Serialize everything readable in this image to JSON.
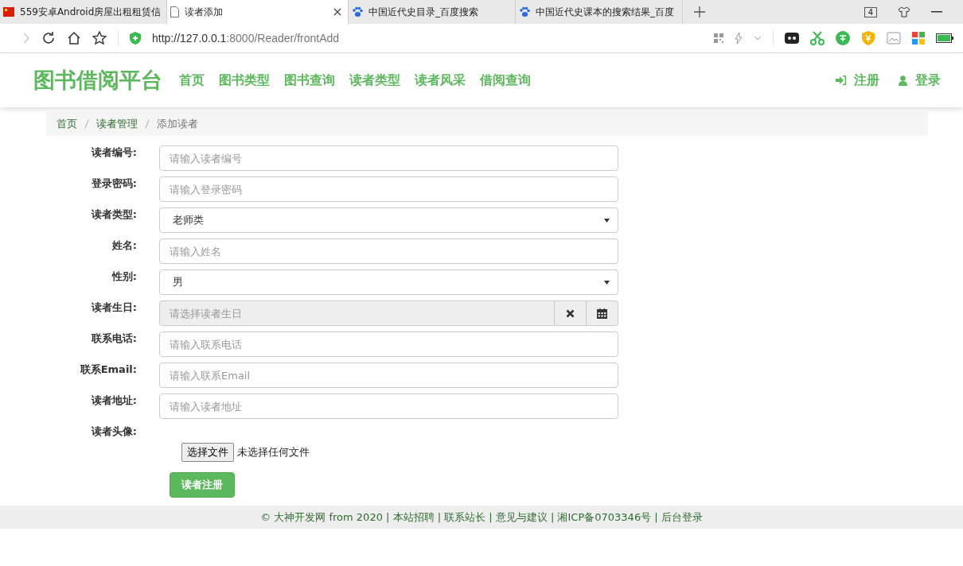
{
  "browser": {
    "tabs": [
      {
        "title": "559安卓Android房屋出租租赁信",
        "selected": false
      },
      {
        "title": "读者添加",
        "selected": true
      },
      {
        "title": "中国近代史目录_百度搜索",
        "selected": false
      },
      {
        "title": "中国近代史课本的搜索结果_百度",
        "selected": false
      }
    ],
    "tab_count": "4",
    "url_host": "http://127.0.0.1",
    "url_rest": ":8000/Reader/frontAdd"
  },
  "navbar": {
    "brand": "图书借阅平台",
    "links": [
      "首页",
      "图书类型",
      "图书查询",
      "读者类型",
      "读者风采",
      "借阅查询"
    ],
    "actions": [
      "注册",
      "登录"
    ]
  },
  "breadcrumb": [
    "首页",
    "读者管理",
    "添加读者"
  ],
  "form": {
    "fields": [
      {
        "label": "读者编号:",
        "kind": "text",
        "placeholder": "请输入读者编号"
      },
      {
        "label": "登录密码:",
        "kind": "text",
        "placeholder": "请输入登录密码"
      },
      {
        "label": "读者类型:",
        "kind": "select",
        "value": "老师类"
      },
      {
        "label": "姓名:",
        "kind": "text",
        "placeholder": "请输入姓名"
      },
      {
        "label": "性别:",
        "kind": "select",
        "value": "男"
      },
      {
        "label": "读者生日:",
        "kind": "date",
        "placeholder": "请选择读者生日"
      },
      {
        "label": "联系电话:",
        "kind": "text",
        "placeholder": "请输入联系电话"
      },
      {
        "label": "联系Email:",
        "kind": "text",
        "placeholder": "请输入联系Email"
      },
      {
        "label": "读者地址:",
        "kind": "text",
        "placeholder": "请输入读者地址"
      },
      {
        "label": "读者头像:",
        "kind": "file",
        "button": "选择文件",
        "status": "未选择任何文件"
      }
    ],
    "submit": "读者注册"
  },
  "footer": "© 大神开发网 from 2020 | 本站招聘 | 联系站长 | 意见与建议 | 湘ICP备0703346号 | 后台登录"
}
